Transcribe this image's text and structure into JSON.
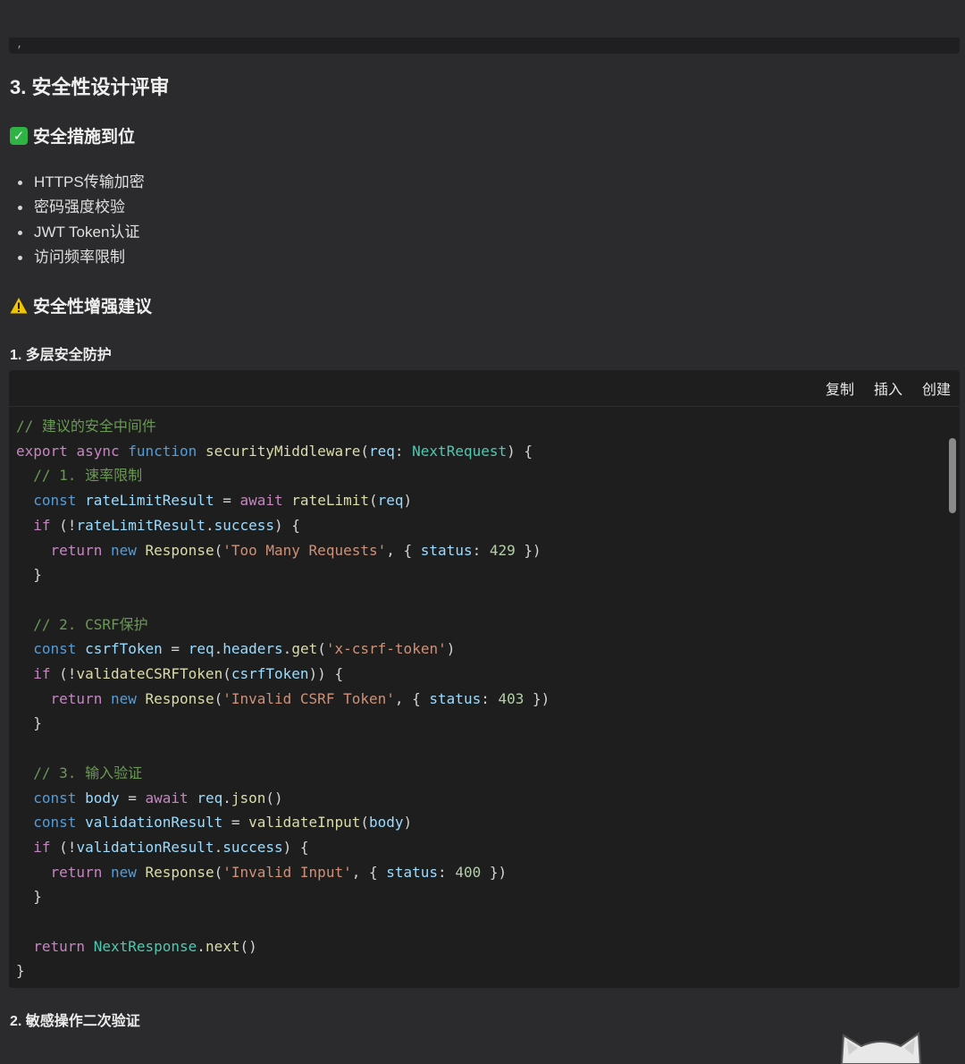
{
  "section": {
    "title": "3. 安全性设计评审"
  },
  "good": {
    "heading": "安全措施到位",
    "icon": "check-box-icon",
    "items": [
      "HTTPS传输加密",
      "密码强度校验",
      "JWT Token认证",
      "访问频率限制"
    ]
  },
  "warn": {
    "heading": "安全性增强建议",
    "icon": "warning-icon"
  },
  "steps": {
    "one": "1. 多层安全防护",
    "two": "2. 敏感操作二次验证"
  },
  "code_toolbar": {
    "copy": "复制",
    "insert": "插入",
    "create": "创建"
  },
  "code": [
    "// 建议的安全中间件",
    "export async function securityMiddleware(req: NextRequest) {",
    "  // 1. 速率限制",
    "  const rateLimitResult = await rateLimit(req)",
    "  if (!rateLimitResult.success) {",
    "    return new Response('Too Many Requests', { status: 429 })",
    "  }",
    "",
    "  // 2. CSRF保护",
    "  const csrfToken = req.headers.get('x-csrf-token')",
    "  if (!validateCSRFToken(csrfToken)) {",
    "    return new Response('Invalid CSRF Token', { status: 403 })",
    "  }",
    "",
    "  // 3. 输入验证",
    "  const body = await req.json()",
    "  const validationResult = validateInput(body)",
    "  if (!validationResult.success) {",
    "    return new Response('Invalid Input', { status: 400 })",
    "  }",
    "",
    "  return NextResponse.next()",
    "}"
  ],
  "colors": {
    "background": "#2b2b2d",
    "code_bg": "#1e1e1f",
    "check": "#2fb344",
    "warning": "#f2c300"
  }
}
